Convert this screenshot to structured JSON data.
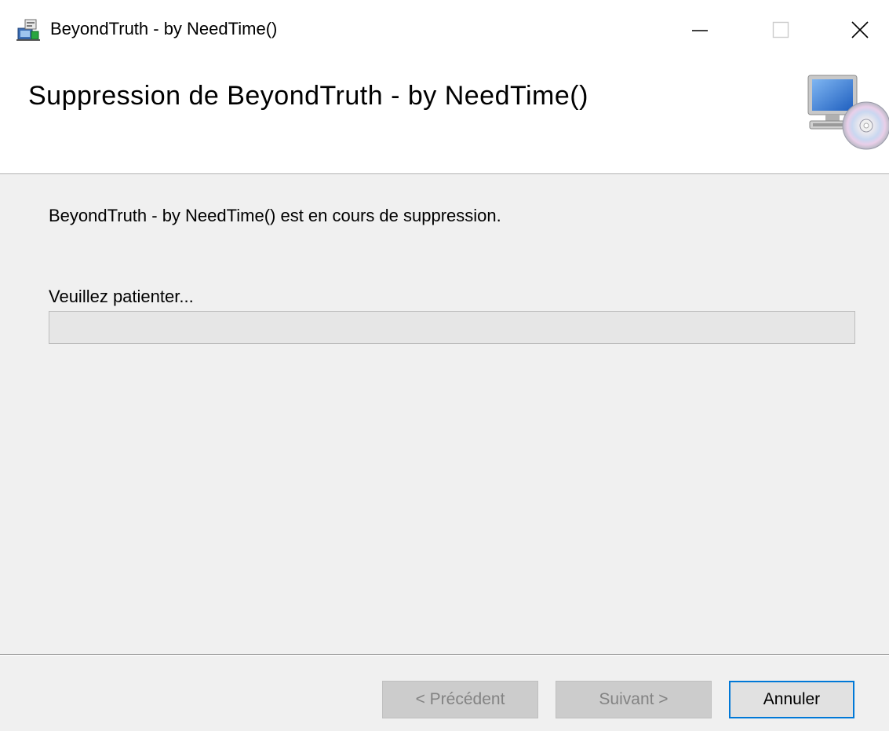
{
  "window": {
    "title": "BeyondTruth - by NeedTime()",
    "controls": {
      "minimize": "minimize-icon",
      "maximize": "maximize-icon",
      "close": "close-icon"
    }
  },
  "header": {
    "title": "Suppression de BeyondTruth - by NeedTime()",
    "icon": "computer-cd-icon"
  },
  "body": {
    "status_text": "BeyondTruth - by NeedTime() est en cours de suppression.",
    "wait_label": "Veuillez patienter...",
    "progress_percent": 0
  },
  "footer": {
    "prev_label": "< Précédent",
    "next_label": "Suivant >",
    "cancel_label": "Annuler"
  },
  "colors": {
    "accent": "#0078d7",
    "panel_bg": "#f0f0f0",
    "disabled_text": "#838383"
  }
}
